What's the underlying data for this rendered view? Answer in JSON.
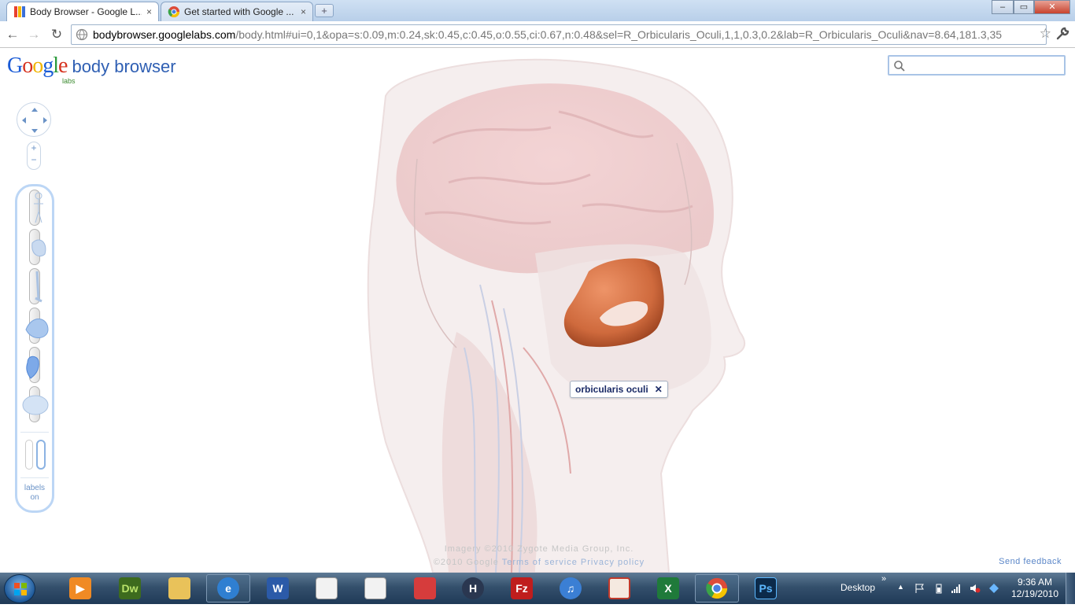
{
  "browser": {
    "tabs": [
      {
        "title": "Body Browser - Google L...",
        "active": true
      },
      {
        "title": "Get started with Google ...",
        "active": false
      }
    ],
    "new_tab": "+",
    "close_glyph": "×",
    "window_buttons": {
      "minimize": "–",
      "maximize": "▭",
      "close": "✕"
    },
    "url": {
      "host": "bodybrowser.googlelabs.com",
      "path": "/body.html#ui=0,1&opa=s:0.09,m:0.24,sk:0.45,c:0.45,o:0.55,ci:0.67,n:0.48&sel=R_Orbicularis_Oculi,1,1,0.3,0.2&lab=R_Orbicularis_Oculi&nav=8.64,181.3,35"
    },
    "nav": {
      "back": "←",
      "forward": "→",
      "reload": "↻",
      "star": "☆"
    }
  },
  "app": {
    "logo": {
      "google": "Google",
      "labs": "labs",
      "product": "body browser"
    },
    "search": {
      "value": "",
      "placeholder": ""
    },
    "zoom": {
      "plus": "+",
      "minus": "−"
    },
    "layers": [
      "skin-layer",
      "muscle-layer",
      "skeleton-layer",
      "organs-layer",
      "circulatory-layer",
      "nervous-layer"
    ],
    "labels_toggle": {
      "line1": "labels",
      "line2": "on"
    },
    "selected_label": {
      "text": "orbicularis oculi",
      "close": "✕"
    },
    "attribution": {
      "imagery": "Imagery ©2010 Zygote Media Group, Inc.",
      "copyright": "©2010 Google",
      "terms": "Terms of service",
      "privacy": "Privacy policy"
    },
    "feedback": "Send feedback",
    "colors": {
      "selected_muscle": "#d2693d",
      "brand_blue": "#2f5fb3"
    }
  },
  "taskbar": {
    "apps": [
      {
        "name": "media-player",
        "label": ""
      },
      {
        "name": "dreamweaver",
        "label": "Dw"
      },
      {
        "name": "explorer",
        "label": ""
      },
      {
        "name": "internet-explorer",
        "label": ""
      },
      {
        "name": "word",
        "label": "W"
      },
      {
        "name": "document-a",
        "label": ""
      },
      {
        "name": "document-b",
        "label": ""
      },
      {
        "name": "package-app",
        "label": ""
      },
      {
        "name": "h-app",
        "label": "H"
      },
      {
        "name": "filezilla",
        "label": "Fz"
      },
      {
        "name": "itunes",
        "label": "♫"
      },
      {
        "name": "image-viewer",
        "label": ""
      },
      {
        "name": "excel",
        "label": "X"
      },
      {
        "name": "chrome",
        "label": ""
      },
      {
        "name": "photoshop",
        "label": "Ps"
      }
    ],
    "desktop_label": "Desktop",
    "desktop_chevron": "»",
    "tray_arrow": "▲",
    "clock": {
      "time": "9:36 AM",
      "date": "12/19/2010"
    }
  }
}
